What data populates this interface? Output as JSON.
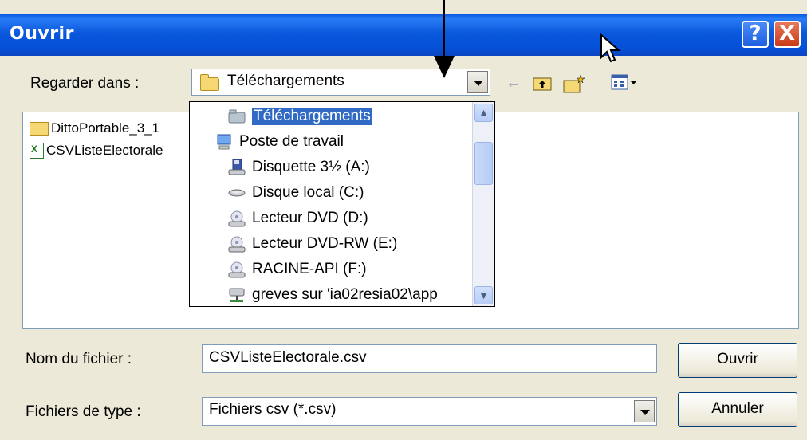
{
  "title": "Ouvrir",
  "titlebar": {
    "help_label": "?",
    "close_label": "X"
  },
  "look_in": {
    "label": "Regarder dans :",
    "value": "Téléchargements"
  },
  "toolbar": {
    "back_icon": "back-arrow-icon",
    "up_icon": "folder-up-icon",
    "new_folder_icon": "new-folder-icon",
    "view_icon": "view-menu-icon"
  },
  "files": [
    {
      "name": "DittoPortable_3_1",
      "icon": "folder-icon"
    },
    {
      "name": "CSVListeElectorale",
      "icon": "excel-file-icon"
    }
  ],
  "dropdown_items": [
    {
      "label": "Téléchargements",
      "icon": "folder-icon",
      "selected": true
    },
    {
      "label": "Poste de travail",
      "icon": "computer-icon"
    },
    {
      "label": "Disquette 3½ (A:)",
      "icon": "floppy-icon"
    },
    {
      "label": "Disque local (C:)",
      "icon": "hard-disk-icon"
    },
    {
      "label": "Lecteur DVD (D:)",
      "icon": "dvd-drive-icon"
    },
    {
      "label": "Lecteur DVD-RW (E:)",
      "icon": "dvd-drive-icon"
    },
    {
      "label": "RACINE-API (F:)",
      "icon": "dvd-drive-icon"
    },
    {
      "label": "greves sur 'ia02resia02\\app",
      "icon": "network-drive-icon"
    }
  ],
  "filename": {
    "label": "Nom du fichier :",
    "value": "CSVListeElectorale.csv"
  },
  "filetype": {
    "label": "Fichiers de type :",
    "value": "Fichiers csv (*.csv)"
  },
  "buttons": {
    "open": "Ouvrir",
    "cancel": "Annuler"
  },
  "colors": {
    "titlebar": "#0a58dc",
    "selection": "#316ac5",
    "dialog_bg": "#ece9d8"
  }
}
